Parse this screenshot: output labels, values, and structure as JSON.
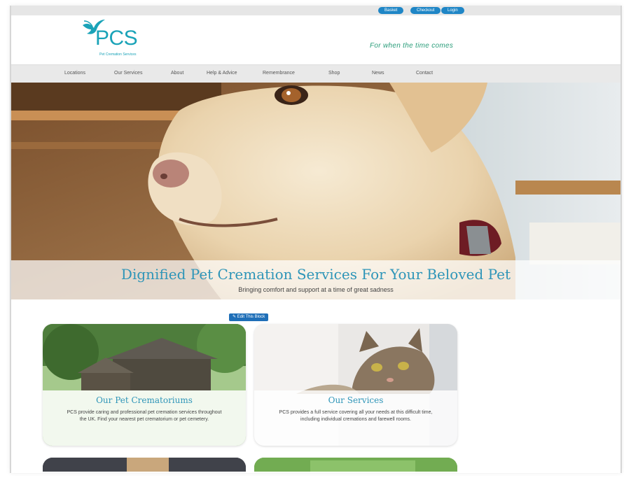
{
  "topbar": {
    "buttons": [
      "Basket",
      "Checkout",
      "Login"
    ]
  },
  "header": {
    "logo_text": "PCS",
    "logo_subtitle": "Pet Cremation Services",
    "tagline": "For when the time comes"
  },
  "nav": {
    "items": [
      "Locations",
      "Our Services",
      "About",
      "Help & Advice",
      "Remembrance",
      "Shop",
      "News",
      "Contact"
    ]
  },
  "hero": {
    "title": "Dignified Pet Cremation Services For Your Beloved Pet",
    "subtitle": "Bringing comfort and support at a time of great sadness"
  },
  "edit_block": {
    "label": "Edit This Block"
  },
  "cards": [
    {
      "title": "Our Pet Crematoriums",
      "description": "PCS provide caring and professional pet cremation services throughout the UK. Find your nearest pet crematorium or pet cemetery."
    },
    {
      "title": "Our Services",
      "description": "PCS provides a full service covering all your needs at this difficult time, including individual cremations and farewell rooms."
    }
  ],
  "colors": {
    "accent": "#2e95b8",
    "brand": "#1aa3b8",
    "button": "#1f86c6",
    "tagline": "#2a9d7a"
  }
}
